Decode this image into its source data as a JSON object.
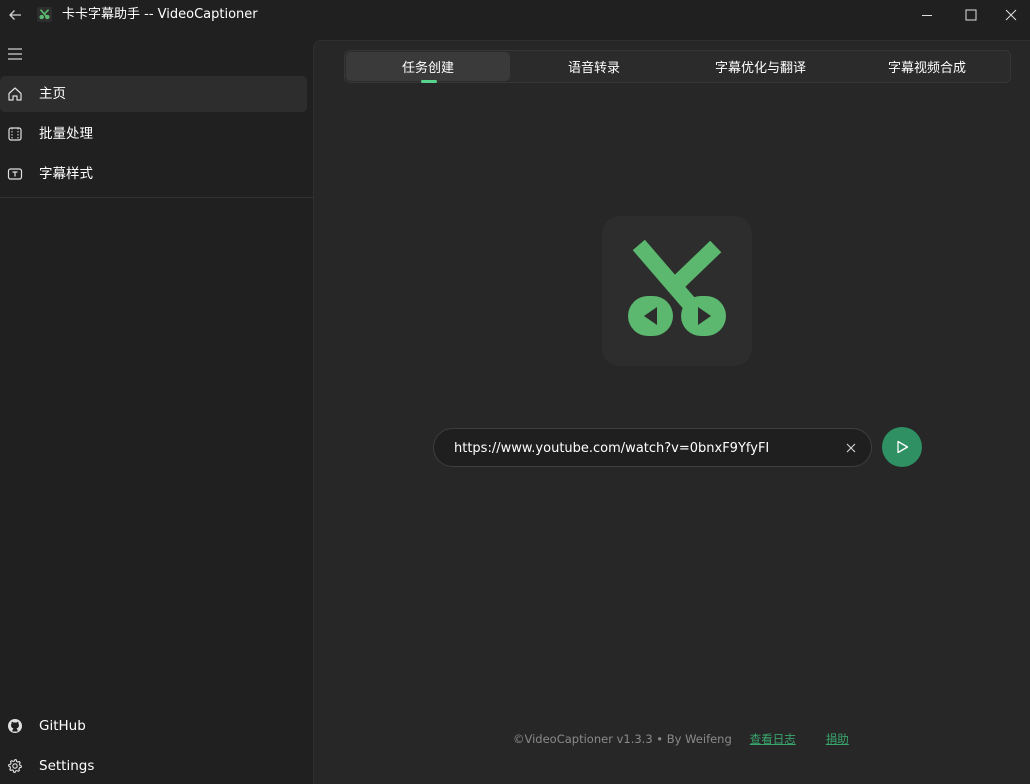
{
  "window": {
    "title": "卡卡字幕助手 -- VideoCaptioner",
    "buttons": {
      "back": "back-arrow-icon",
      "minimize": "minimize-icon",
      "maximize": "maximize-icon",
      "close": "close-icon"
    }
  },
  "sidebar": {
    "items": [
      {
        "label": "主页",
        "icon": "home-icon",
        "active": true
      },
      {
        "label": "批量处理",
        "icon": "batch-icon",
        "active": false
      },
      {
        "label": "字幕样式",
        "icon": "text-style-icon",
        "active": false
      }
    ],
    "bottom": [
      {
        "label": "GitHub",
        "icon": "github-icon"
      },
      {
        "label": "Settings",
        "icon": "gear-icon"
      }
    ]
  },
  "tabs": [
    {
      "label": "任务创建",
      "active": true
    },
    {
      "label": "语音转录",
      "active": false
    },
    {
      "label": "字幕优化与翻译",
      "active": false
    },
    {
      "label": "字幕视频合成",
      "active": false
    }
  ],
  "main": {
    "logo_icon": "scissors-play-logo",
    "url_value": "https://www.youtube.com/watch?v=0bnxF9YfyFI",
    "start_icon": "play-icon",
    "clear_icon": "clear-icon"
  },
  "footer": {
    "copyright": "©VideoCaptioner v1.3.3 • By Weifeng",
    "log_link": "查看日志",
    "donate_link": "捐助"
  },
  "colors": {
    "accent": "#2e9063",
    "accent_light": "#56d48b",
    "logo_green": "#5bb86e",
    "link": "#3aa56d",
    "background": "#202020",
    "panel": "#272727"
  }
}
